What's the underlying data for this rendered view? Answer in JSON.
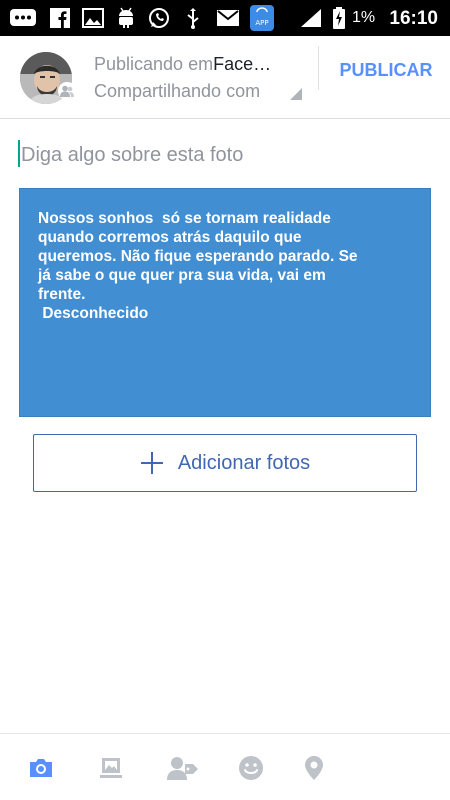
{
  "status_bar": {
    "battery_percent": "1%",
    "time": "16:10",
    "icons": [
      "chat-icon",
      "facebook-icon",
      "gallery-icon",
      "android-icon",
      "whatsapp-icon",
      "usb-icon",
      "gmail-icon",
      "app-store-icon",
      "signal-icon",
      "battery-charging-icon"
    ],
    "app_badge": "APP"
  },
  "header": {
    "publishing_prefix": "Publicando em",
    "publishing_target": "Face…",
    "audience": "Compartilhando com",
    "publish_label": "PUBLICAR"
  },
  "composer": {
    "placeholder": "Diga algo sobre esta foto",
    "value": ""
  },
  "photo": {
    "quote_text": "Nossos sonhos  só se tornam realidade\nquando corremos atrás daquilo que\nqueremos. Não fique esperando parado. Se\njá sabe o que quer pra sua vida, vai em\nfrente.\n Desconhecido",
    "background_color": "#428ed3"
  },
  "add_photos": {
    "label": "Adicionar fotos"
  },
  "bottom_bar": {
    "icons": [
      "camera-icon",
      "album-icon",
      "tag-people-icon",
      "feeling-icon",
      "location-icon"
    ],
    "active_color": "#5890ff",
    "inactive_color": "#bec2c9"
  }
}
